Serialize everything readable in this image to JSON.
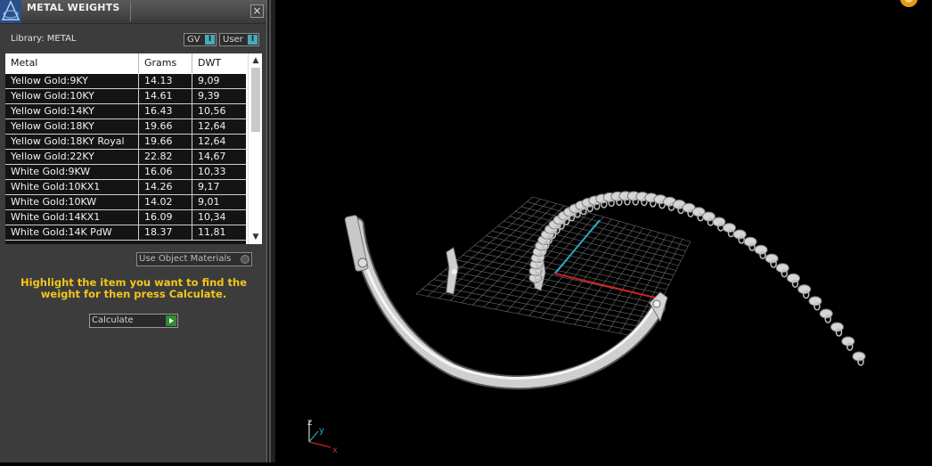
{
  "panel": {
    "title": "METAL WEIGHTS",
    "close_label": "×",
    "library_label": "Library: METAL",
    "toggles": [
      {
        "label": "GV",
        "switch": "I"
      },
      {
        "label": "User",
        "switch": "I"
      }
    ],
    "table": {
      "headers": [
        "Metal",
        "Grams",
        "DWT"
      ],
      "rows": [
        {
          "metal": "Yellow Gold:9KY",
          "grams": "14.13",
          "dwt": "9,09"
        },
        {
          "metal": "Yellow Gold:10KY",
          "grams": "14.61",
          "dwt": "9,39"
        },
        {
          "metal": "Yellow Gold:14KY",
          "grams": "16.43",
          "dwt": "10,56"
        },
        {
          "metal": "Yellow Gold:18KY",
          "grams": "19.66",
          "dwt": "12,64"
        },
        {
          "metal": "Yellow Gold:18KY Royal",
          "grams": "19.66",
          "dwt": "12,64"
        },
        {
          "metal": "Yellow Gold:22KY",
          "grams": "22.82",
          "dwt": "14,67"
        },
        {
          "metal": "White Gold:9KW",
          "grams": "16.06",
          "dwt": "10,33"
        },
        {
          "metal": "White Gold:10KX1",
          "grams": "14.26",
          "dwt": "9,17"
        },
        {
          "metal": "White Gold:10KW",
          "grams": "14.02",
          "dwt": "9,01"
        },
        {
          "metal": "White Gold:14KX1",
          "grams": "16.09",
          "dwt": "10,34"
        },
        {
          "metal": "White Gold:14K PdW",
          "grams": "18.37",
          "dwt": "11,81"
        }
      ]
    },
    "use_object_materials": "Use Object Materials",
    "hint": "Highlight the item you want to find the weight for then press Calculate.",
    "calculate_label": "Calculate"
  },
  "viewport": {
    "axes": {
      "x": "x",
      "y": "y",
      "z": "z"
    },
    "colors": {
      "grid": "#7a7a7a",
      "x_axis": "#cc2222",
      "y_axis": "#2aa6c8",
      "metal": "#d6d6d6"
    }
  }
}
